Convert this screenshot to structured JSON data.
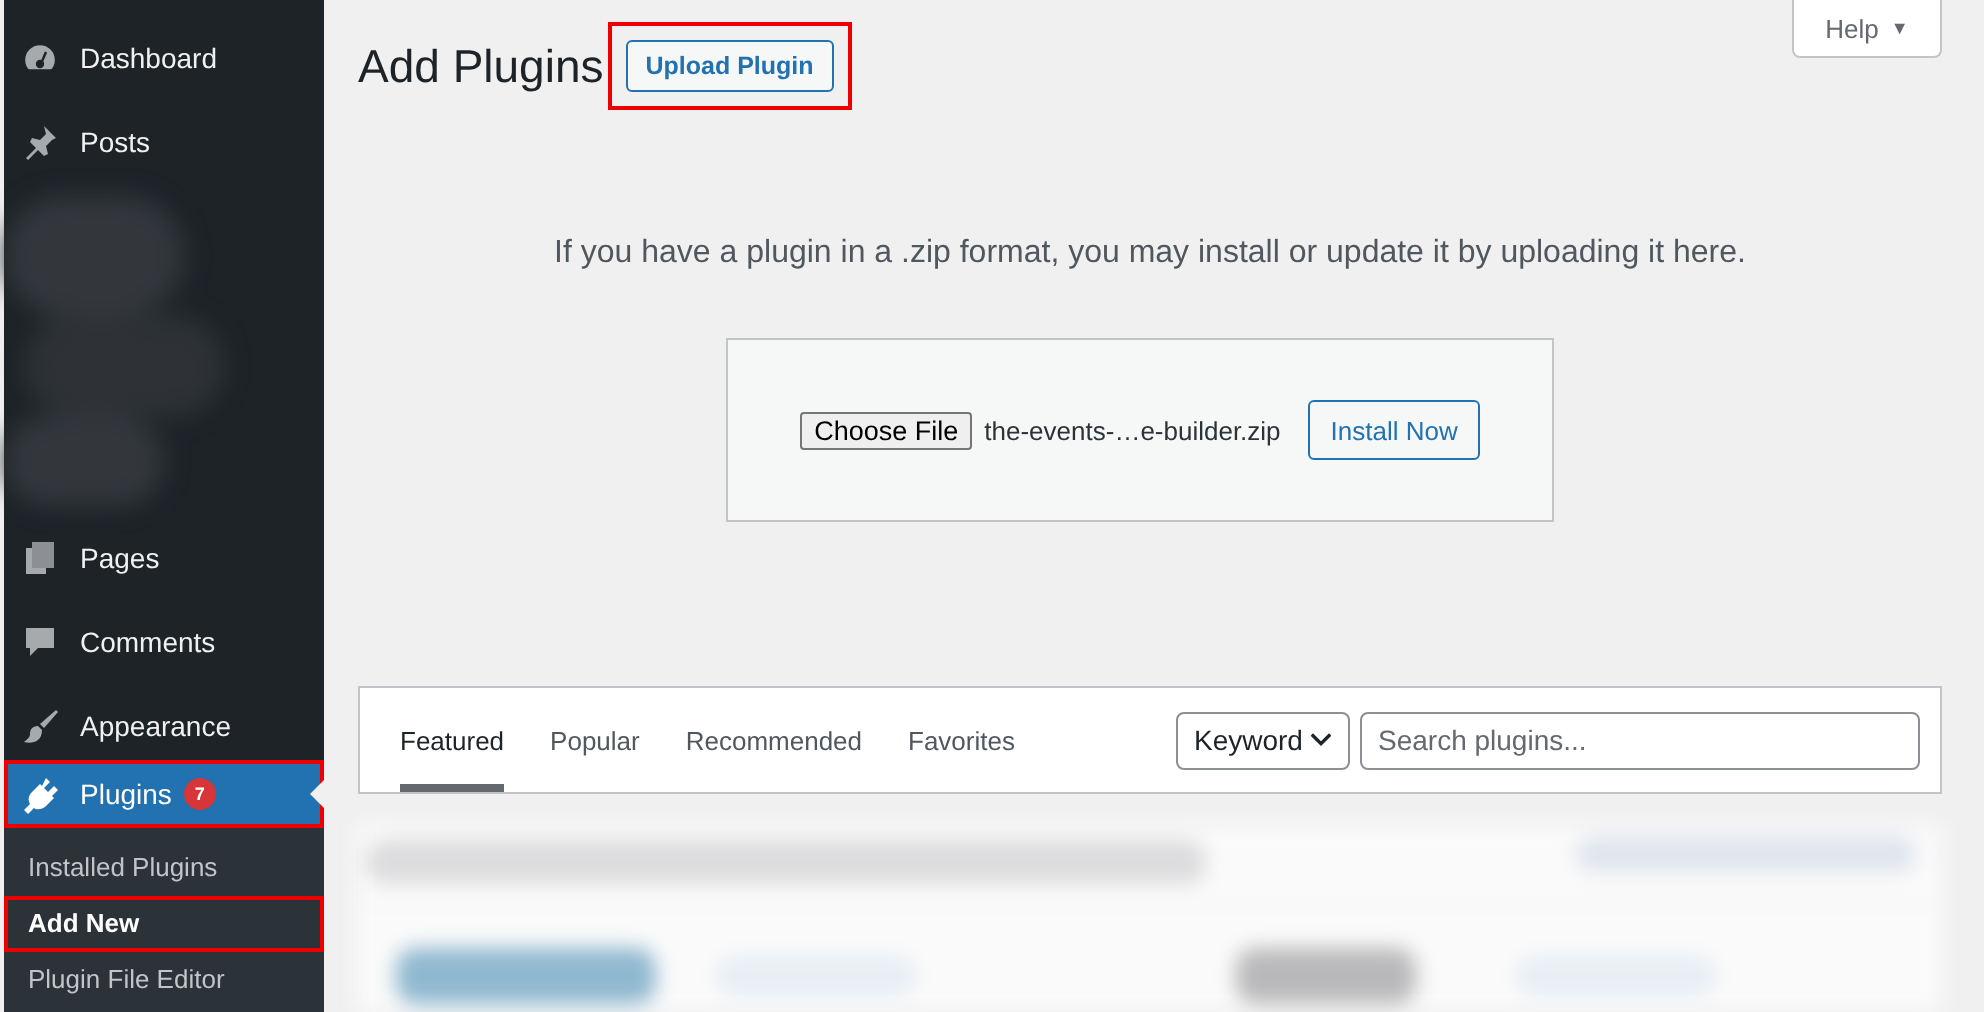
{
  "sidebar": {
    "items": [
      {
        "kind": "menu",
        "label": "Dashboard",
        "selected": false,
        "highlighted": false
      },
      {
        "kind": "menu",
        "label": "Posts",
        "selected": false,
        "highlighted": false
      },
      {
        "kind": "blurred"
      },
      {
        "kind": "menu",
        "label": "Pages",
        "selected": false,
        "highlighted": false
      },
      {
        "kind": "menu",
        "label": "Comments",
        "selected": false,
        "highlighted": false
      },
      {
        "kind": "menu",
        "label": "Appearance",
        "selected": false,
        "highlighted": false
      },
      {
        "kind": "menu",
        "label": "Plugins",
        "badge": "7",
        "selected": true,
        "highlighted": true
      }
    ],
    "submenu": [
      {
        "label": "Installed Plugins",
        "selected": false,
        "highlighted": false
      },
      {
        "label": "Add New",
        "selected": true,
        "highlighted": true
      },
      {
        "label": "Plugin File Editor",
        "selected": false,
        "highlighted": false
      }
    ]
  },
  "header": {
    "title": "Add Plugins",
    "upload_button": {
      "label": "Upload Plugin",
      "highlighted": true
    },
    "help_tab": {
      "label": "Help",
      "caret": "▼"
    }
  },
  "upload_section": {
    "message": "If you have a plugin in a .zip format, you may install or update it by uploading it here.",
    "file_button": "Choose File",
    "file_name": "the-events-…e-builder.zip",
    "install_button": "Install Now"
  },
  "filter_bar": {
    "tabs": [
      {
        "label": "Featured",
        "selected": true
      },
      {
        "label": "Popular",
        "selected": false
      },
      {
        "label": "Recommended",
        "selected": false
      },
      {
        "label": "Favorites",
        "selected": false
      }
    ],
    "search_type": "Keyword",
    "search": {
      "placeholder": "Search plugins..."
    }
  },
  "plugin_list": {
    "kind": "blurred"
  }
}
